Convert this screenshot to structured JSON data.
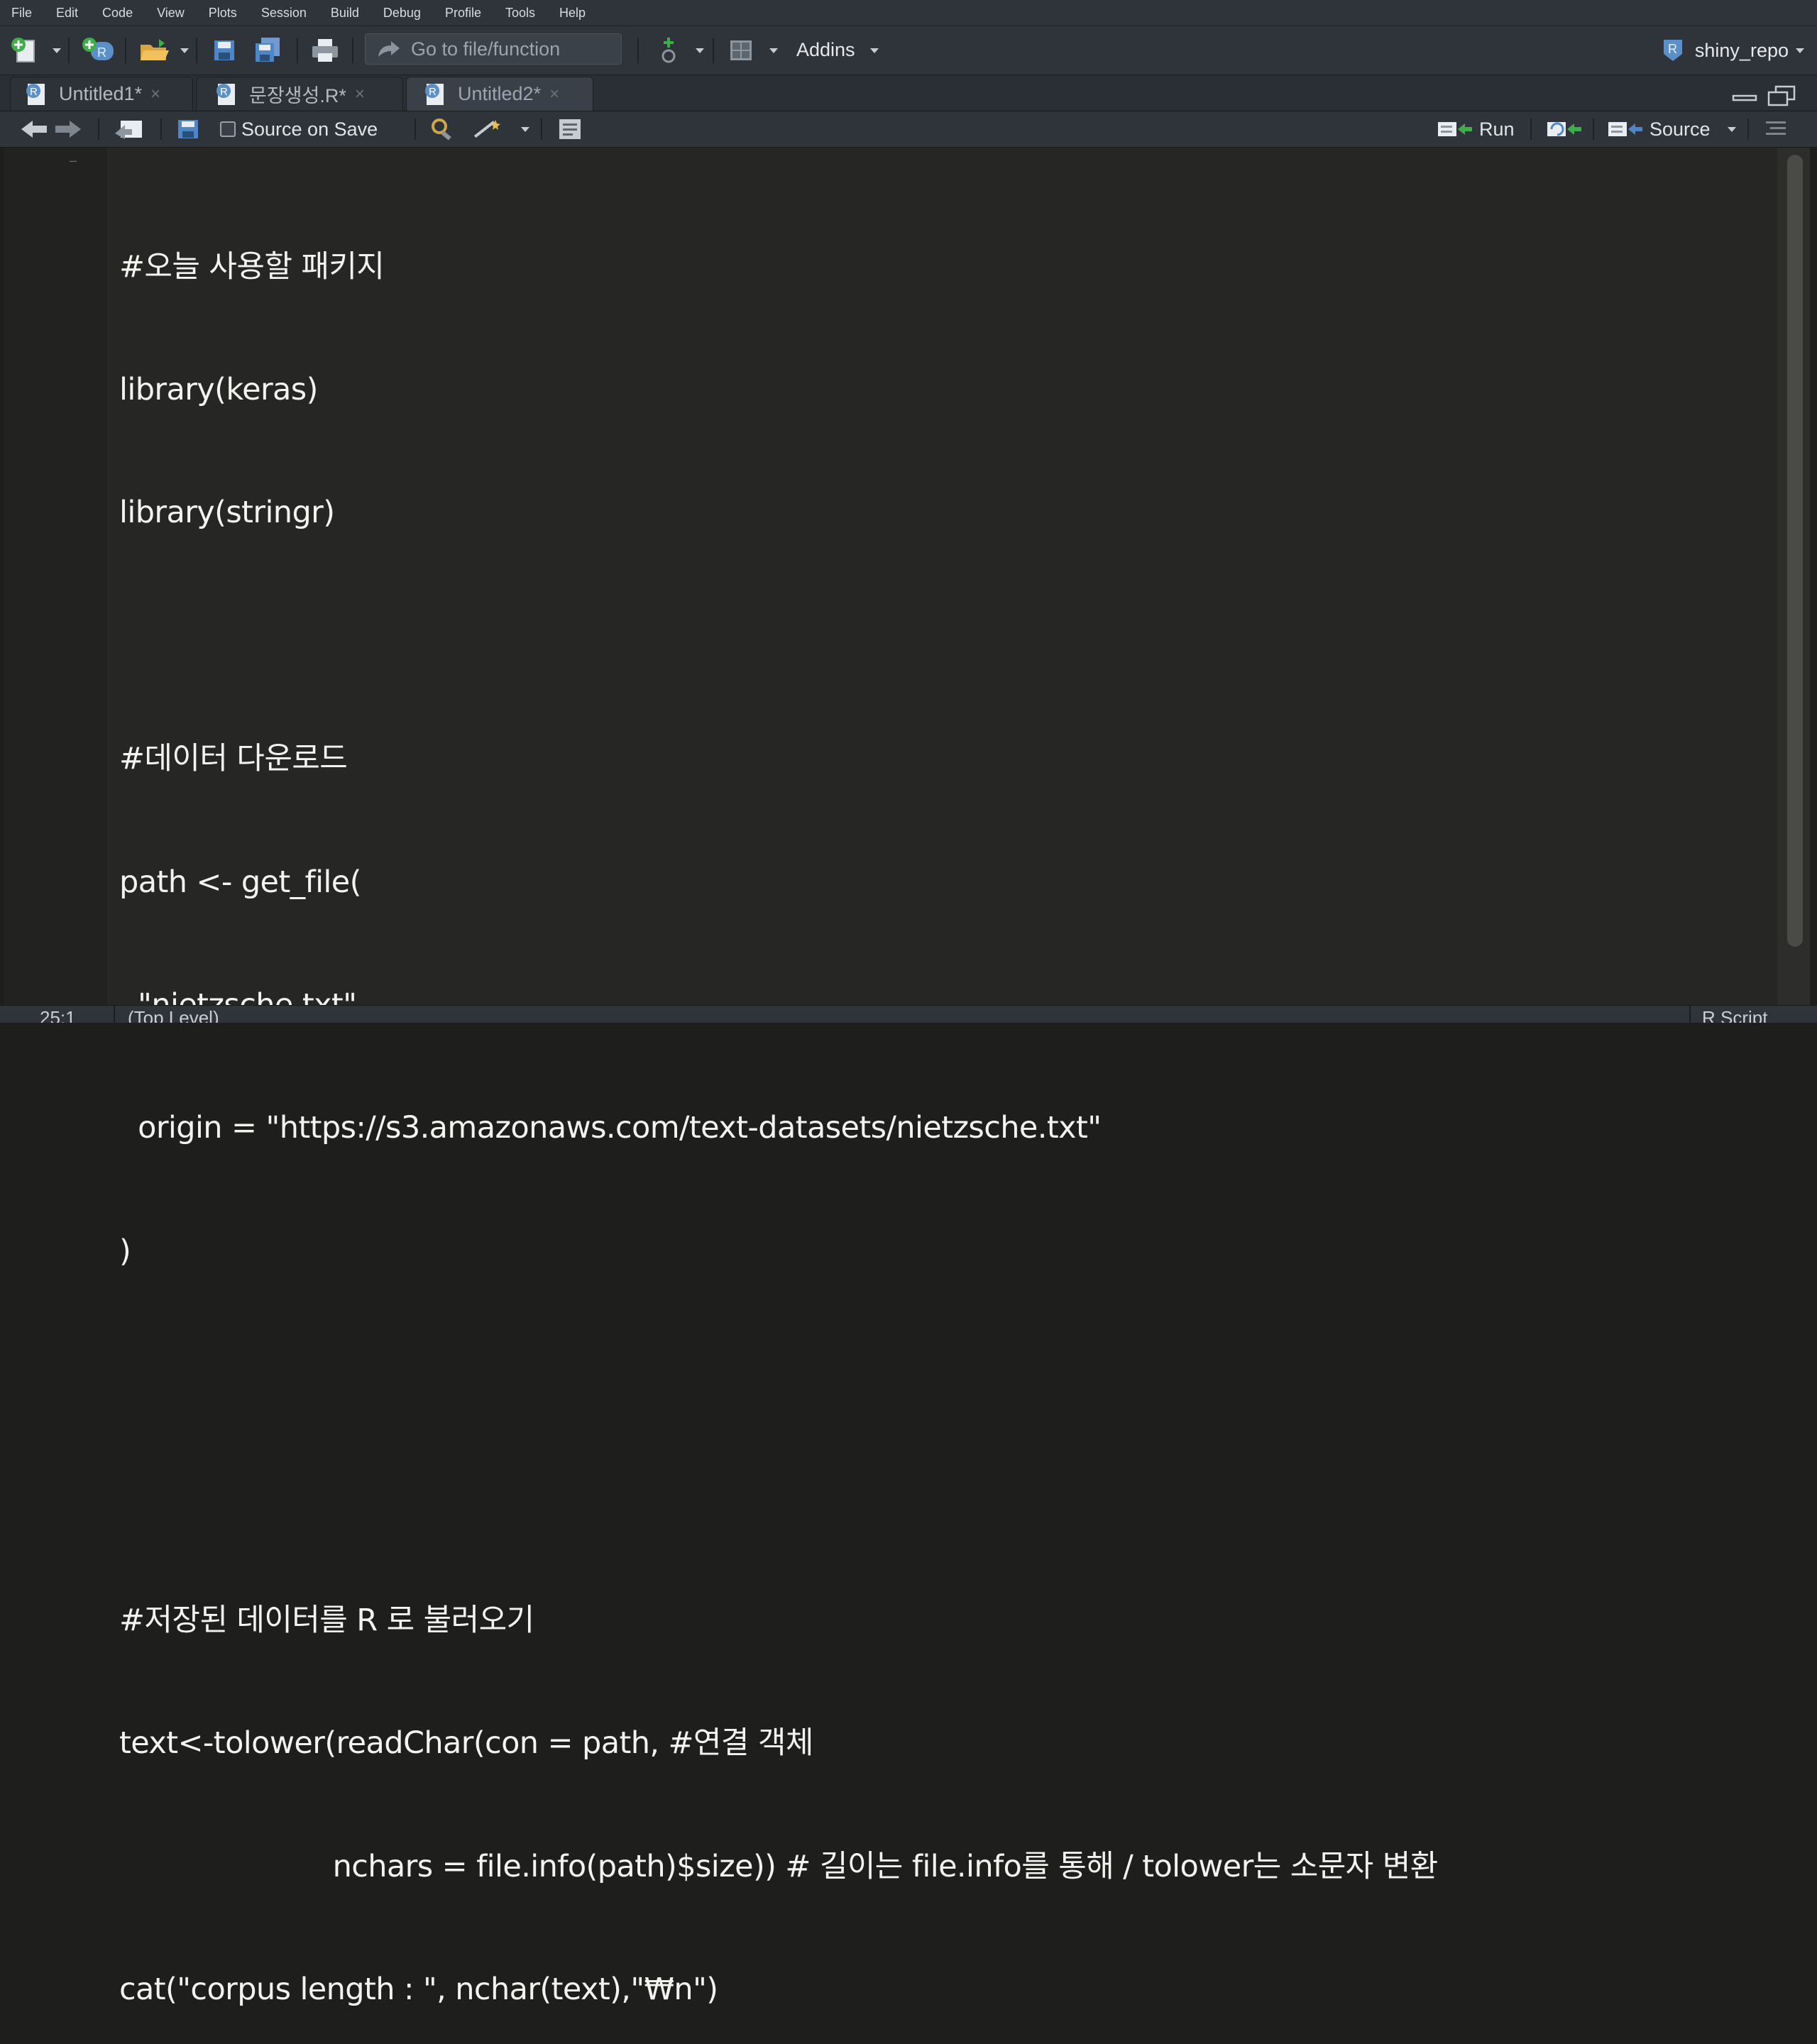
{
  "menu": [
    "File",
    "Edit",
    "Code",
    "View",
    "Plots",
    "Session",
    "Build",
    "Debug",
    "Profile",
    "Tools",
    "Help"
  ],
  "toolbar": {
    "goto_placeholder": "Go to file/function",
    "addins_label": "Addins",
    "project_label": "shiny_repo"
  },
  "tabs": [
    {
      "label": "Untitled1*",
      "close": "×",
      "active": false
    },
    {
      "label": "문장생성.R*",
      "close": "×",
      "active": false
    },
    {
      "label": "Untitled2*",
      "close": "×",
      "active": true
    }
  ],
  "editor_toolbar": {
    "source_on_save_label": "Source on Save",
    "run_label": "Run",
    "source_label": "Source"
  },
  "code_lines": [
    "#오늘 사용할 패키지",
    "library(keras)",
    "library(stringr)",
    "",
    "#데이터 다운로드",
    "path <- get_file(",
    "  \"nietzsche.txt\",",
    "  origin = \"https://s3.amazonaws.com/text-datasets/nietzsche.txt\"",
    ")",
    "",
    "",
    "#저장된 데이터를 R 로 불러오기",
    "text<-tolower(readChar(con = path, #연결 객체",
    "                       nchars = file.info(path)$size)) # 길이는 file.info를 통해 / tolower는 소문자 변환",
    "cat(\"corpus length : \", nchar(text),\"₩n\")"
  ],
  "status": {
    "cursor_position": "25:1",
    "scope": "(Top Level)",
    "file_type": "R Script"
  },
  "colors": {
    "chrome": "#2f343a",
    "editor_bg": "#262624",
    "code_text": "#f3f3f0",
    "accent_green": "#3fae49",
    "icon_blue": "#5b8fc8"
  }
}
